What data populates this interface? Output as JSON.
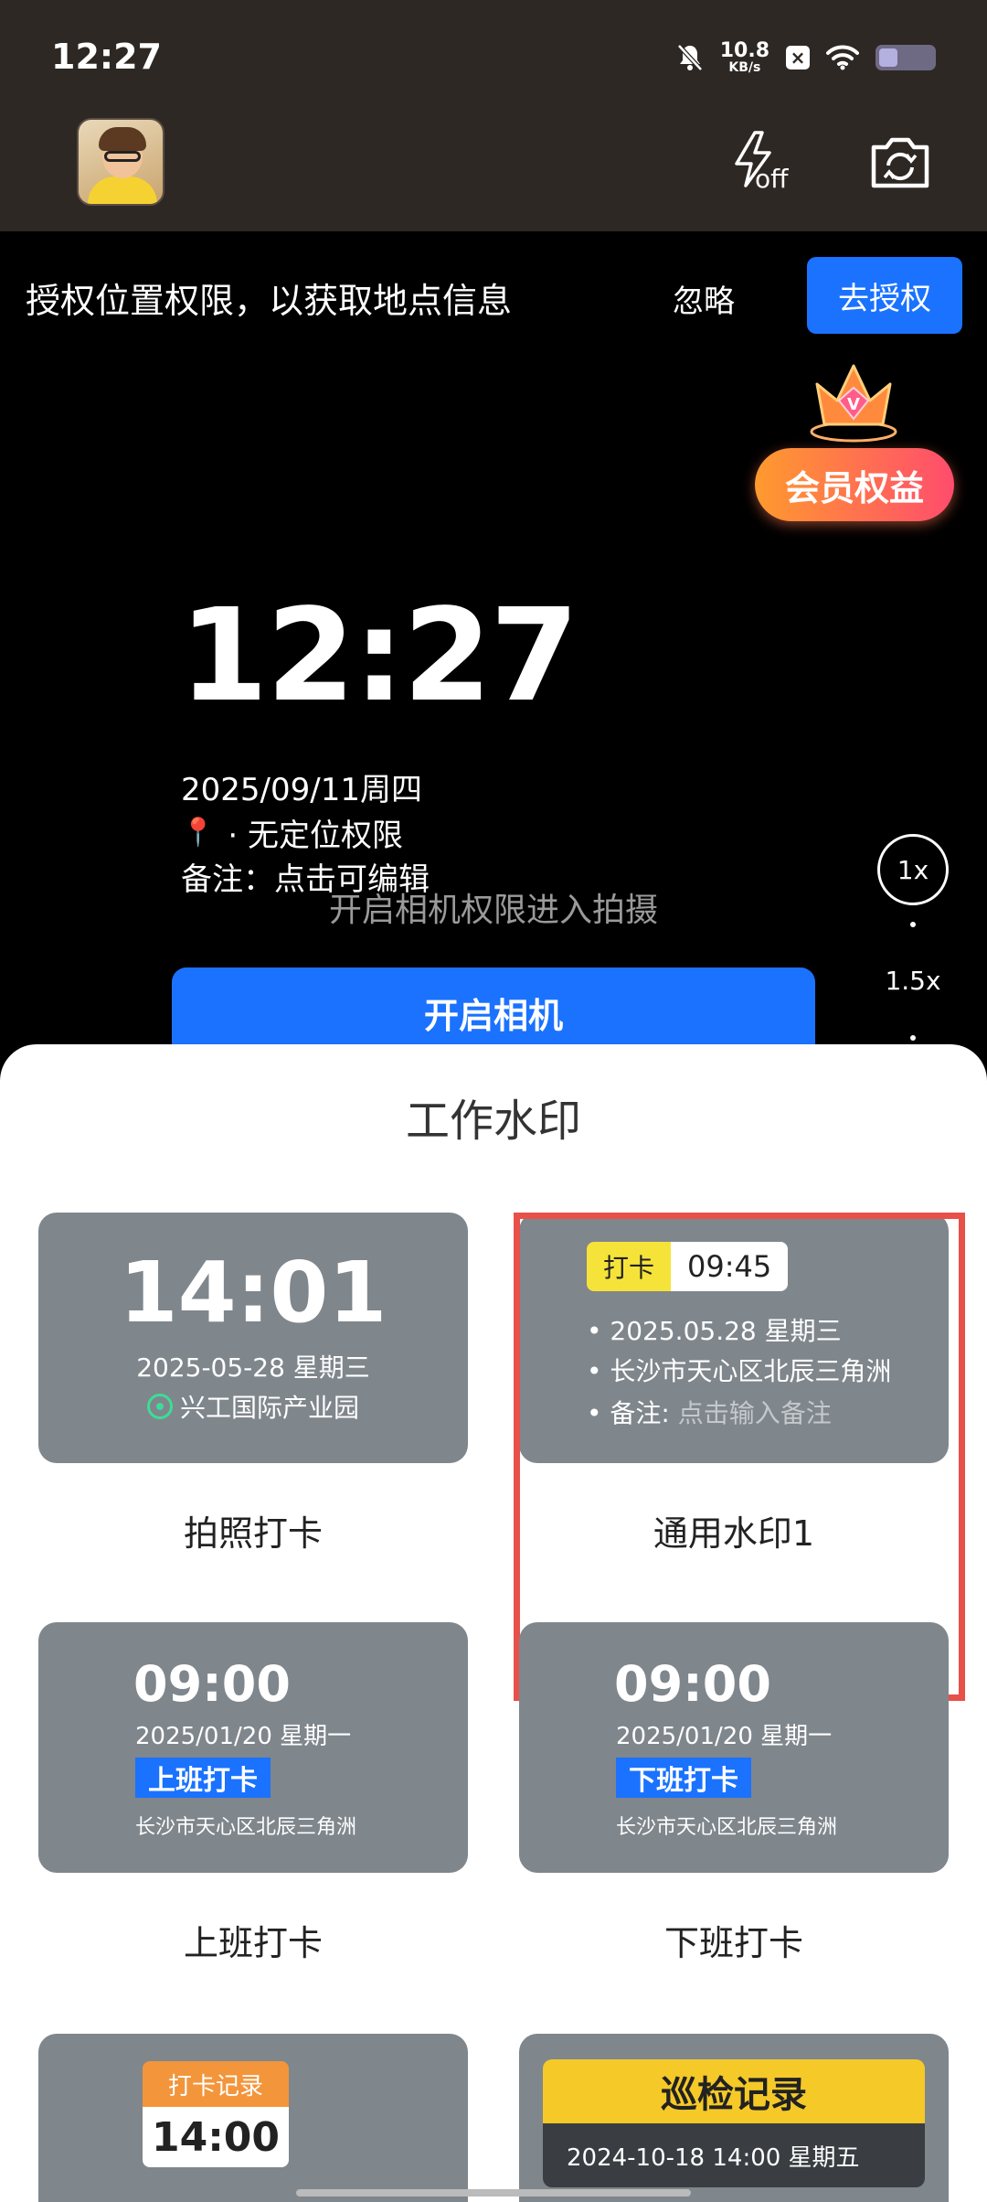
{
  "status_bar": {
    "time": "12:27",
    "net_speed_value": "10.8",
    "net_speed_unit": "KB/s",
    "icons": [
      "mute-bell-icon",
      "x-app-icon",
      "wifi-icon",
      "battery-icon"
    ],
    "battery_level": 0.35
  },
  "top_bar": {
    "flash_state": "off",
    "flash_icon": "flash-off-icon",
    "flip_icon": "camera-flip-icon"
  },
  "permission_banner": {
    "text": "授权位置权限，以获取地点信息",
    "ignore_label": "忽略",
    "authorize_label": "去授权"
  },
  "vip_badge": {
    "label": "会员权益",
    "letter": "V"
  },
  "preview_watermark": {
    "time": "12:27",
    "date": "2025/09/11周四",
    "location": "· 无定位权限",
    "note": "备注：点击可编辑"
  },
  "camera_hint": "开启相机权限进入拍摄",
  "open_camera_label": "开启相机",
  "zoom": {
    "level_1": "1x",
    "level_2": "1.5x"
  },
  "sheet": {
    "title": "工作水印",
    "cards": [
      {
        "label": "拍照打卡",
        "time": "14:01",
        "date": "2025-05-28  星期三",
        "location": "兴工国际产业园"
      },
      {
        "label": "通用水印1",
        "tag": "打卡",
        "time": "09:45",
        "date": "2025.05.28  星期三",
        "address": "长沙市天心区北辰三角洲",
        "note_label": "备注:",
        "note_placeholder": "点击输入备注"
      },
      {
        "label": "上班打卡",
        "time": "09:00",
        "date": "2025/01/20  星期一",
        "badge": "上班打卡",
        "address": "长沙市天心区北辰三角洲"
      },
      {
        "label": "下班打卡",
        "time": "09:00",
        "date": "2025/01/20  星期一",
        "badge": "下班打卡",
        "address": "长沙市天心区北辰三角洲"
      },
      {
        "header": "打卡记录",
        "time": "14:00"
      },
      {
        "header": "巡检记录",
        "sub": "2024-10-18  14:00  星期五"
      }
    ]
  },
  "colors": {
    "accent_blue": "#1a72ff",
    "selection_red": "#e8504a",
    "thumb_gray": "#7f868c",
    "top_bar_brown": "#2e2824"
  }
}
